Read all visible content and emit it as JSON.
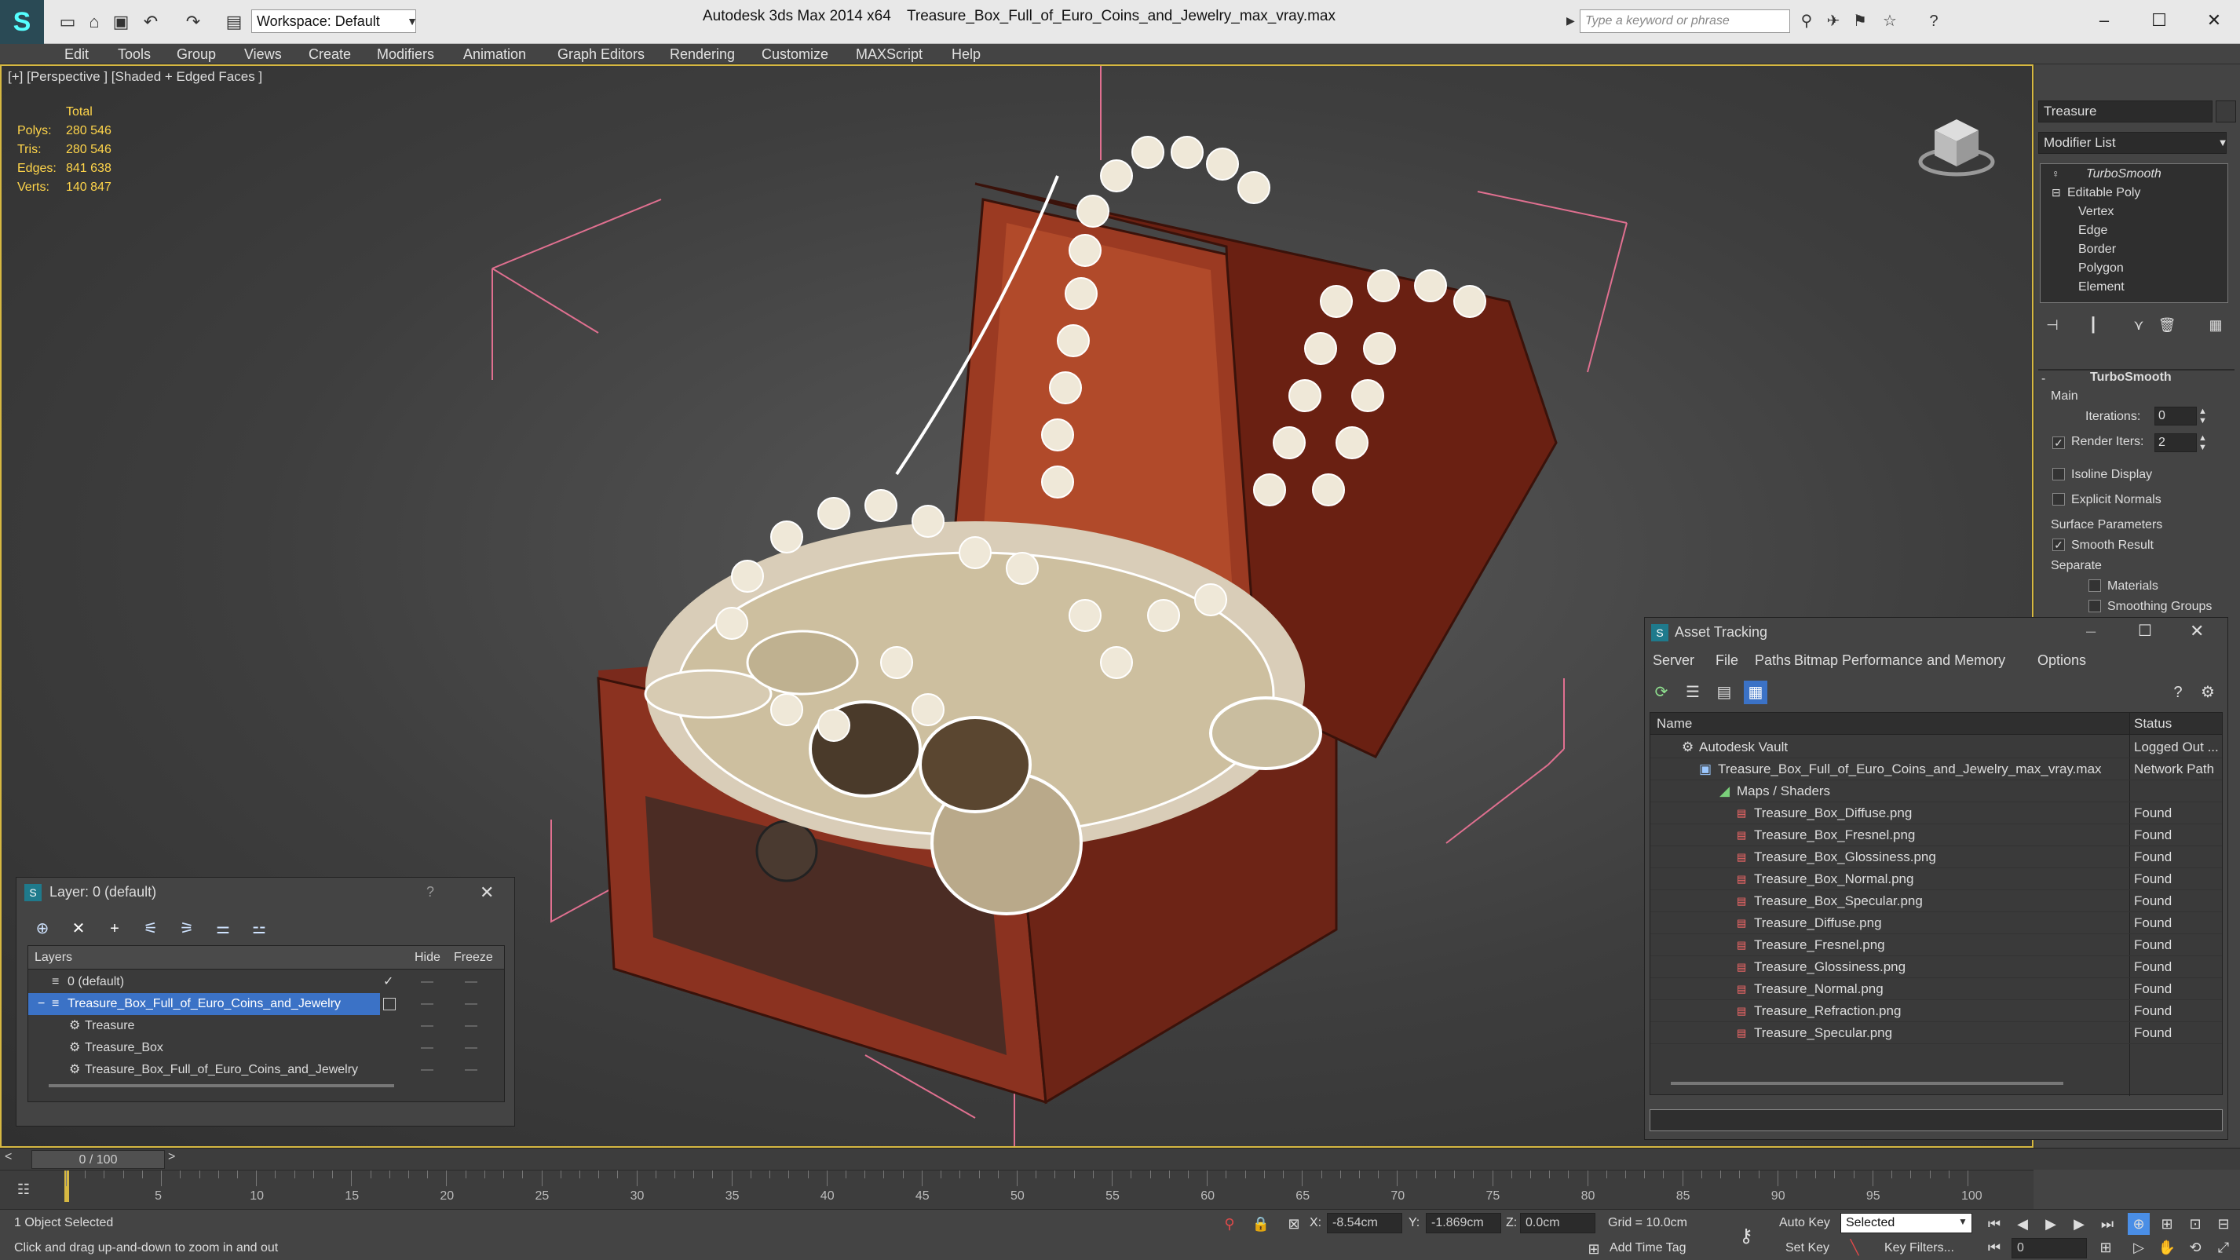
{
  "titlebar": {
    "workspace_label": "Workspace: Default",
    "app_title": "Autodesk 3ds Max  2014 x64",
    "file_title": "Treasure_Box_Full_of_Euro_Coins_and_Jewelry_max_vray.max",
    "search_placeholder": "Type a keyword or phrase"
  },
  "menu": [
    "Edit",
    "Tools",
    "Group",
    "Views",
    "Create",
    "Modifiers",
    "Animation",
    "Graph Editors",
    "Rendering",
    "Customize",
    "MAXScript",
    "Help"
  ],
  "viewport": {
    "label": "[+] [Perspective ] [Shaded + Edged Faces ]",
    "stats_header": "Total",
    "stats": [
      {
        "label": "Polys:",
        "value": "280 546"
      },
      {
        "label": "Tris:",
        "value": "280 546"
      },
      {
        "label": "Edges:",
        "value": "841 638"
      },
      {
        "label": "Verts:",
        "value": "140 847"
      }
    ]
  },
  "command_panel": {
    "object_name": "Treasure",
    "modifier_list": "Modifier List",
    "stack": [
      "TurboSmooth",
      "Editable Poly",
      "Vertex",
      "Edge",
      "Border",
      "Polygon",
      "Element"
    ],
    "rollout_title": "TurboSmooth",
    "main_label": "Main",
    "iterations_label": "Iterations:",
    "iterations_value": "0",
    "render_iters_label": "Render Iters:",
    "render_iters_value": "2",
    "isoline_label": "Isoline Display",
    "explicit_normals_label": "Explicit Normals",
    "surface_params_label": "Surface Parameters",
    "smooth_result_label": "Smooth Result",
    "separate_label": "Separate",
    "materials_label": "Materials",
    "smoothing_groups_label": "Smoothing Groups"
  },
  "layer_panel": {
    "title": "Layer: 0 (default)",
    "help": "?",
    "col_layers": "Layers",
    "col_hide": "Hide",
    "col_freeze": "Freeze",
    "rows": [
      "0 (default)",
      "Treasure_Box_Full_of_Euro_Coins_and_Jewelry",
      "Treasure",
      "Treasure_Box",
      "Treasure_Box_Full_of_Euro_Coins_and_Jewelry"
    ]
  },
  "asset_tracking": {
    "title": "Asset Tracking",
    "menu": [
      "Server",
      "File",
      "Paths",
      "Bitmap Performance and Memory",
      "Options"
    ],
    "col_name": "Name",
    "col_status": "Status",
    "rows": [
      {
        "name": "Autodesk Vault",
        "status": "Logged Out ..."
      },
      {
        "name": "Treasure_Box_Full_of_Euro_Coins_and_Jewelry_max_vray.max",
        "status": "Network Path"
      },
      {
        "name": "Maps / Shaders",
        "status": ""
      },
      {
        "name": "Treasure_Box_Diffuse.png",
        "status": "Found"
      },
      {
        "name": "Treasure_Box_Fresnel.png",
        "status": "Found"
      },
      {
        "name": "Treasure_Box_Glossiness.png",
        "status": "Found"
      },
      {
        "name": "Treasure_Box_Normal.png",
        "status": "Found"
      },
      {
        "name": "Treasure_Box_Specular.png",
        "status": "Found"
      },
      {
        "name": "Treasure_Diffuse.png",
        "status": "Found"
      },
      {
        "name": "Treasure_Fresnel.png",
        "status": "Found"
      },
      {
        "name": "Treasure_Glossiness.png",
        "status": "Found"
      },
      {
        "name": "Treasure_Normal.png",
        "status": "Found"
      },
      {
        "name": "Treasure_Refraction.png",
        "status": "Found"
      },
      {
        "name": "Treasure_Specular.png",
        "status": "Found"
      }
    ]
  },
  "timeline": {
    "frame_display": "0 / 100",
    "prev": "<",
    "next": ">",
    "ticks": [
      "5",
      "10",
      "15",
      "20",
      "25",
      "30",
      "35",
      "40",
      "45",
      "50",
      "55",
      "60",
      "65",
      "70",
      "75",
      "80",
      "85",
      "90",
      "95",
      "100"
    ]
  },
  "statusbar": {
    "selection": "1 Object Selected",
    "prompt": "Click and drag up-and-down to zoom in and out",
    "x_label": "X:",
    "x_value": "-8.54cm",
    "y_label": "Y:",
    "y_value": "-1.869cm",
    "z_label": "Z:",
    "z_value": "0.0cm",
    "grid": "Grid = 10.0cm",
    "add_time_tag": "Add Time Tag",
    "auto_key": "Auto Key",
    "selected": "Selected",
    "set_key": "Set Key",
    "key_filters": "Key Filters...",
    "frame_value": "0"
  }
}
